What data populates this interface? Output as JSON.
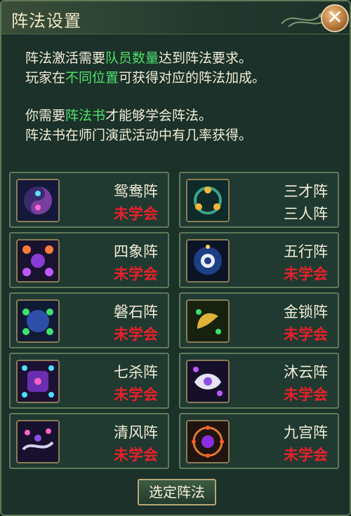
{
  "window": {
    "title": "阵法设置",
    "close_label": "✕"
  },
  "description": {
    "line1": {
      "a": "阵法激活需要",
      "b": "队员数量",
      "c": "达到阵法要求。"
    },
    "line2": {
      "a": "玩家在",
      "b": "不同位置",
      "c": "可获得对应的阵法加成。"
    },
    "line3": {
      "a": "你需要",
      "b": "阵法书",
      "c": "才能够学会阵法。"
    },
    "line4": "阵法书在师门演武活动中有几率获得。"
  },
  "colors": {
    "highlight": "#4fe06b",
    "status_unlearned": "#e8202a",
    "text": "#f2edd8"
  },
  "formations": [
    {
      "name": "鸳鸯阵",
      "status": "未学会",
      "icon": "yuanyang-formation-icon"
    },
    {
      "name": "三才阵",
      "status": "三人阵",
      "icon": "sancai-formation-icon"
    },
    {
      "name": "四象阵",
      "status": "未学会",
      "icon": "sixiang-formation-icon"
    },
    {
      "name": "五行阵",
      "status": "未学会",
      "icon": "wuxing-formation-icon"
    },
    {
      "name": "磐石阵",
      "status": "未学会",
      "icon": "panshi-formation-icon"
    },
    {
      "name": "金锁阵",
      "status": "未学会",
      "icon": "jinsuo-formation-icon"
    },
    {
      "name": "七杀阵",
      "status": "未学会",
      "icon": "qisha-formation-icon"
    },
    {
      "name": "沐云阵",
      "status": "未学会",
      "icon": "muyun-formation-icon"
    },
    {
      "name": "清风阵",
      "status": "未学会",
      "icon": "qingfeng-formation-icon"
    },
    {
      "name": "九宫阵",
      "status": "未学会",
      "icon": "jiugong-formation-icon"
    }
  ],
  "footer": {
    "select_label": "选定阵法"
  }
}
